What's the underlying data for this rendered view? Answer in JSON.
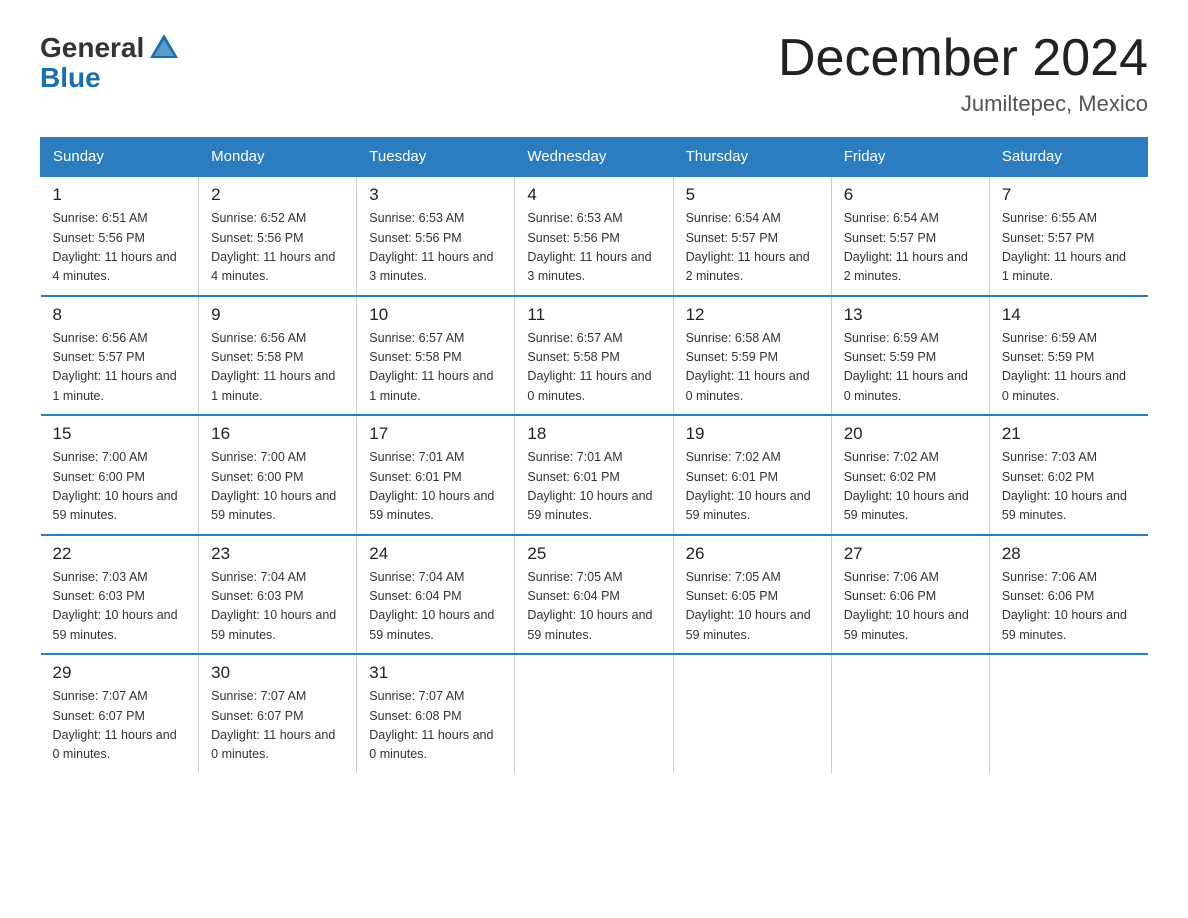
{
  "header": {
    "logo_general": "General",
    "logo_blue": "Blue",
    "title": "December 2024",
    "subtitle": "Jumiltepec, Mexico"
  },
  "days_of_week": [
    "Sunday",
    "Monday",
    "Tuesday",
    "Wednesday",
    "Thursday",
    "Friday",
    "Saturday"
  ],
  "weeks": [
    [
      {
        "day": "1",
        "sunrise": "6:51 AM",
        "sunset": "5:56 PM",
        "daylight": "11 hours and 4 minutes."
      },
      {
        "day": "2",
        "sunrise": "6:52 AM",
        "sunset": "5:56 PM",
        "daylight": "11 hours and 4 minutes."
      },
      {
        "day": "3",
        "sunrise": "6:53 AM",
        "sunset": "5:56 PM",
        "daylight": "11 hours and 3 minutes."
      },
      {
        "day": "4",
        "sunrise": "6:53 AM",
        "sunset": "5:56 PM",
        "daylight": "11 hours and 3 minutes."
      },
      {
        "day": "5",
        "sunrise": "6:54 AM",
        "sunset": "5:57 PM",
        "daylight": "11 hours and 2 minutes."
      },
      {
        "day": "6",
        "sunrise": "6:54 AM",
        "sunset": "5:57 PM",
        "daylight": "11 hours and 2 minutes."
      },
      {
        "day": "7",
        "sunrise": "6:55 AM",
        "sunset": "5:57 PM",
        "daylight": "11 hours and 1 minute."
      }
    ],
    [
      {
        "day": "8",
        "sunrise": "6:56 AM",
        "sunset": "5:57 PM",
        "daylight": "11 hours and 1 minute."
      },
      {
        "day": "9",
        "sunrise": "6:56 AM",
        "sunset": "5:58 PM",
        "daylight": "11 hours and 1 minute."
      },
      {
        "day": "10",
        "sunrise": "6:57 AM",
        "sunset": "5:58 PM",
        "daylight": "11 hours and 1 minute."
      },
      {
        "day": "11",
        "sunrise": "6:57 AM",
        "sunset": "5:58 PM",
        "daylight": "11 hours and 0 minutes."
      },
      {
        "day": "12",
        "sunrise": "6:58 AM",
        "sunset": "5:59 PM",
        "daylight": "11 hours and 0 minutes."
      },
      {
        "day": "13",
        "sunrise": "6:59 AM",
        "sunset": "5:59 PM",
        "daylight": "11 hours and 0 minutes."
      },
      {
        "day": "14",
        "sunrise": "6:59 AM",
        "sunset": "5:59 PM",
        "daylight": "11 hours and 0 minutes."
      }
    ],
    [
      {
        "day": "15",
        "sunrise": "7:00 AM",
        "sunset": "6:00 PM",
        "daylight": "10 hours and 59 minutes."
      },
      {
        "day": "16",
        "sunrise": "7:00 AM",
        "sunset": "6:00 PM",
        "daylight": "10 hours and 59 minutes."
      },
      {
        "day": "17",
        "sunrise": "7:01 AM",
        "sunset": "6:01 PM",
        "daylight": "10 hours and 59 minutes."
      },
      {
        "day": "18",
        "sunrise": "7:01 AM",
        "sunset": "6:01 PM",
        "daylight": "10 hours and 59 minutes."
      },
      {
        "day": "19",
        "sunrise": "7:02 AM",
        "sunset": "6:01 PM",
        "daylight": "10 hours and 59 minutes."
      },
      {
        "day": "20",
        "sunrise": "7:02 AM",
        "sunset": "6:02 PM",
        "daylight": "10 hours and 59 minutes."
      },
      {
        "day": "21",
        "sunrise": "7:03 AM",
        "sunset": "6:02 PM",
        "daylight": "10 hours and 59 minutes."
      }
    ],
    [
      {
        "day": "22",
        "sunrise": "7:03 AM",
        "sunset": "6:03 PM",
        "daylight": "10 hours and 59 minutes."
      },
      {
        "day": "23",
        "sunrise": "7:04 AM",
        "sunset": "6:03 PM",
        "daylight": "10 hours and 59 minutes."
      },
      {
        "day": "24",
        "sunrise": "7:04 AM",
        "sunset": "6:04 PM",
        "daylight": "10 hours and 59 minutes."
      },
      {
        "day": "25",
        "sunrise": "7:05 AM",
        "sunset": "6:04 PM",
        "daylight": "10 hours and 59 minutes."
      },
      {
        "day": "26",
        "sunrise": "7:05 AM",
        "sunset": "6:05 PM",
        "daylight": "10 hours and 59 minutes."
      },
      {
        "day": "27",
        "sunrise": "7:06 AM",
        "sunset": "6:06 PM",
        "daylight": "10 hours and 59 minutes."
      },
      {
        "day": "28",
        "sunrise": "7:06 AM",
        "sunset": "6:06 PM",
        "daylight": "10 hours and 59 minutes."
      }
    ],
    [
      {
        "day": "29",
        "sunrise": "7:07 AM",
        "sunset": "6:07 PM",
        "daylight": "11 hours and 0 minutes."
      },
      {
        "day": "30",
        "sunrise": "7:07 AM",
        "sunset": "6:07 PM",
        "daylight": "11 hours and 0 minutes."
      },
      {
        "day": "31",
        "sunrise": "7:07 AM",
        "sunset": "6:08 PM",
        "daylight": "11 hours and 0 minutes."
      },
      null,
      null,
      null,
      null
    ]
  ],
  "labels": {
    "sunrise": "Sunrise:",
    "sunset": "Sunset:",
    "daylight": "Daylight:"
  }
}
